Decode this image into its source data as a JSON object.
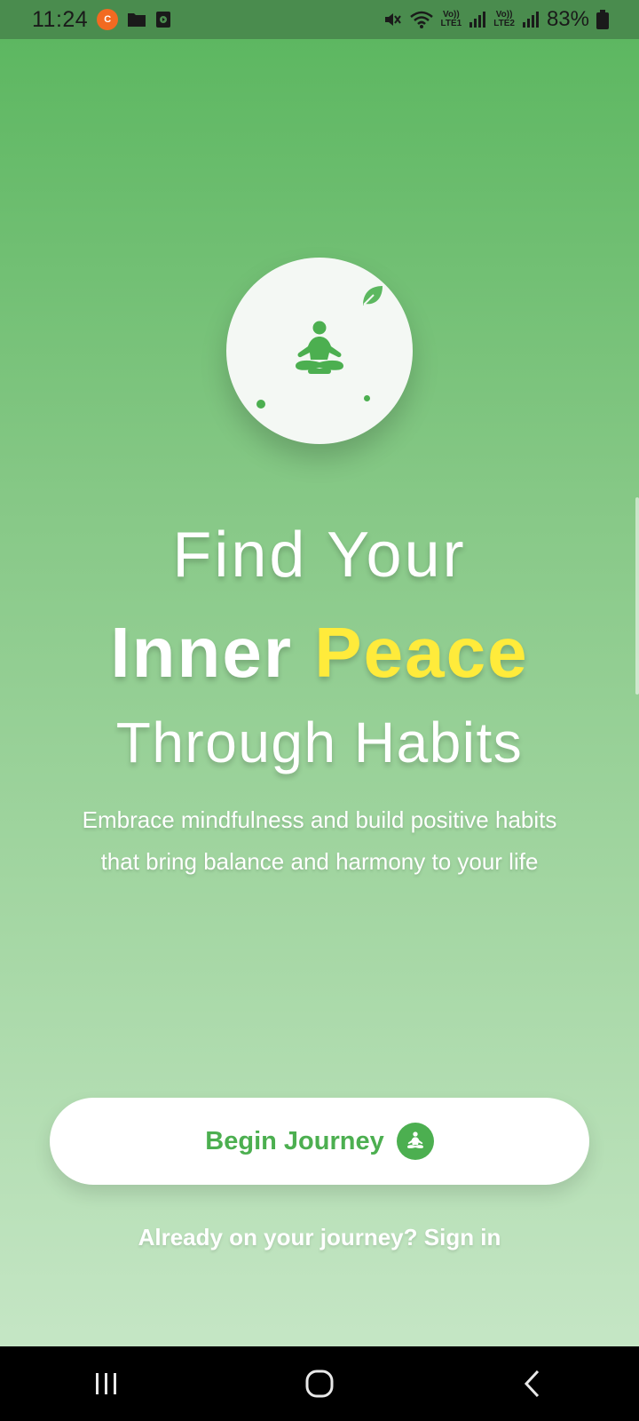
{
  "status_bar": {
    "time": "11:24",
    "app_icon_letter": "C",
    "sim1_label_top": "Vo))",
    "sim1_label_bottom": "LTE1",
    "sim2_label_top": "Vo))",
    "sim2_label_bottom": "LTE2",
    "battery": "83%",
    "icons": [
      "app-notification-icon",
      "folder-icon",
      "media-icon",
      "mute-icon",
      "wifi-icon",
      "signal-icon",
      "battery-icon"
    ]
  },
  "hero": {
    "logo_icon": "meditation-icon",
    "leaf_icon": "leaf-icon"
  },
  "headline": {
    "line1": "Find Your",
    "line2_main": "Inner ",
    "line2_accent": "Peace",
    "line3": "Through Habits"
  },
  "subtitle": {
    "line1": "Embrace mindfulness and build positive habits",
    "line2": "that bring balance and harmony to your life"
  },
  "actions": {
    "begin_label": "Begin Journey",
    "signin_text": "Already on your journey? Sign in"
  },
  "colors": {
    "accent_green": "#4caf50",
    "accent_yellow": "#ffeb3b",
    "gradient_top": "#5db761",
    "gradient_bottom": "#c5e6c5"
  },
  "nav_bar": {
    "icons": [
      "recents-icon",
      "home-icon",
      "back-icon"
    ]
  }
}
